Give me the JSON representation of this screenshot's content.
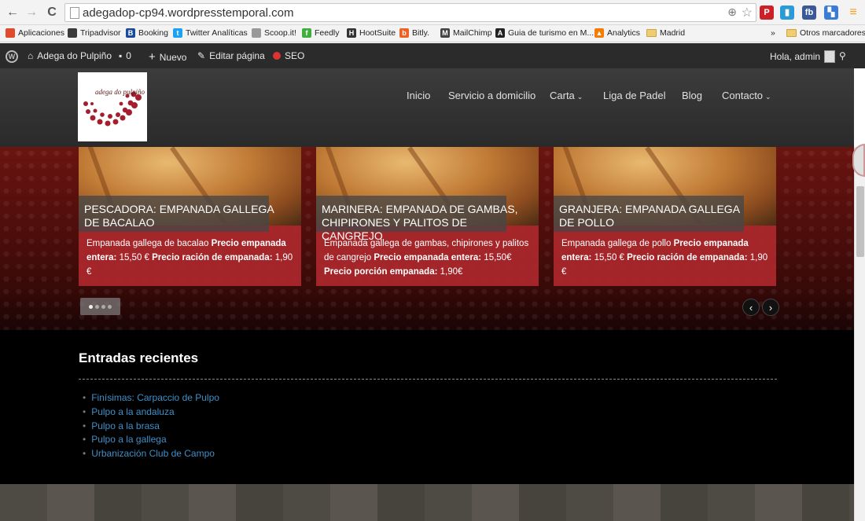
{
  "browser": {
    "url": "adegadop-cp94.wordpresstemporal.com",
    "back": "←",
    "forward": "→",
    "reload": "C",
    "zoom_glyph": "⊕",
    "star_glyph": "☆",
    "extensions": [
      {
        "name": "pinterest",
        "glyph": "P",
        "color": "#cb2027"
      },
      {
        "name": "buffer",
        "glyph": "▮",
        "color": "#2b9bd8"
      },
      {
        "name": "facebook",
        "glyph": "fb",
        "color": "#3b5998"
      },
      {
        "name": "apps-tiles",
        "glyph": "▚",
        "color": "#3a7bd5"
      },
      {
        "name": "menu",
        "glyph": "≡",
        "color": "#f4a020"
      }
    ]
  },
  "bookmarks": [
    {
      "label": "Aplicaciones",
      "icon": "apps-grid-icon",
      "color": "#e04b2b"
    },
    {
      "label": "Tripadvisor",
      "icon": "owl-icon",
      "color": "#3a3a3a"
    },
    {
      "label": "Booking",
      "icon": "booking-icon",
      "color": "#1c4a9a",
      "glyph": "B"
    },
    {
      "label": "Twitter Analíticas",
      "icon": "twitter-icon",
      "color": "#1da1f2",
      "glyph": "t"
    },
    {
      "label": "Scoop.it!",
      "icon": "page-icon",
      "color": "#999"
    },
    {
      "label": "Feedly",
      "icon": "feedly-icon",
      "color": "#3fae3f",
      "glyph": "f"
    },
    {
      "label": "HootSuite",
      "icon": "hootsuite-icon",
      "color": "#333",
      "glyph": "H"
    },
    {
      "label": "Bitly.",
      "icon": "bitly-icon",
      "color": "#ee6123",
      "glyph": "b"
    },
    {
      "label": "MailChimp",
      "icon": "mailchimp-icon",
      "color": "#444",
      "glyph": "M"
    },
    {
      "label": "Guia de turismo en M...",
      "icon": "guide-icon",
      "color": "#222",
      "glyph": "A"
    },
    {
      "label": "Analytics",
      "icon": "analytics-icon",
      "color": "#f57c00",
      "glyph": "▲"
    },
    {
      "label": "Madrid",
      "icon": "folder-icon"
    }
  ],
  "bookmarks_more": "»",
  "bookmarks_other": "Otros marcadores",
  "wp_bar": {
    "site": "Adega do Pulpiño",
    "comments": "0",
    "new": "Nuevo",
    "edit": "Editar página",
    "seo": "SEO",
    "greeting": "Hola, admin"
  },
  "menu": [
    {
      "label": "Inicio",
      "dropdown": false
    },
    {
      "label": "Servicio a domicilio",
      "dropdown": false
    },
    {
      "label": "Carta",
      "dropdown": true
    },
    {
      "label": "Liga de Padel",
      "dropdown": false
    },
    {
      "label": "Blog",
      "dropdown": false
    },
    {
      "label": "Contacto",
      "dropdown": true
    }
  ],
  "logo_text": "adega do pulpiño",
  "slides": [
    {
      "title": "PESCADORA: EMPANADA GALLEGA DE BACALAO",
      "desc": "Empanada gallega de bacalao",
      "price1_label": "Precio empanada entera:",
      "price1": "15,50 €",
      "price2_label": "Precio ración de empanada:",
      "price2": "1,90 €"
    },
    {
      "title": "MARINERA: EMPANADA DE GAMBAS, CHIPIRONES Y PALITOS DE CANGREJO",
      "desc": "Empanada gallega de gambas, chipirones y palitos de cangrejo",
      "price1_label": "Precio empanada entera:",
      "price1": "15,50€",
      "price2_label": "Precio porción empanada:",
      "price2": "1,90€"
    },
    {
      "title": "GRANJERA: EMPANADA GALLEGA DE POLLO",
      "desc": "Empanada gallega de pollo",
      "price1_label": "Precio empanada entera:",
      "price1": "15,50 €",
      "price2_label": "Precio ración de empanada:",
      "price2": "1,90 €"
    }
  ],
  "slider_prev": "‹",
  "slider_next": "›",
  "recent": {
    "title": "Entradas recientes",
    "posts": [
      "Finísimas: Carpaccio de Pulpo",
      "Pulpo a la andaluza",
      "Pulpo a la brasa",
      "Pulpo a la gallega",
      "Urbanización Club de Campo"
    ]
  }
}
